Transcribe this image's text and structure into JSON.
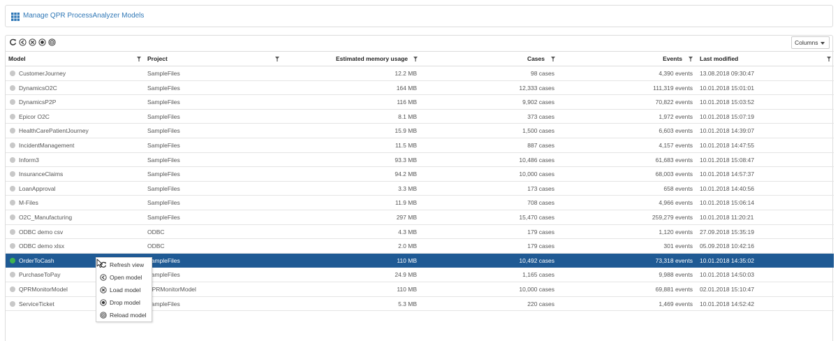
{
  "header": {
    "title": "Manage QPR ProcessAnalyzer Models",
    "icon": "grid-icon"
  },
  "toolbar": {
    "icons": [
      "refresh-icon",
      "open-icon",
      "load-icon",
      "drop-icon",
      "reload-icon"
    ],
    "columns_label": "Columns"
  },
  "table": {
    "headers": {
      "model": "Model",
      "project": "Project",
      "memory": "Estimated memory usage",
      "cases": "Cases",
      "events": "Events",
      "last_modified": "Last modified"
    },
    "rows": [
      {
        "model": "CustomerJourney",
        "project": "SampleFiles",
        "memory": "12.2 MB",
        "cases": "98 cases",
        "events": "4,390 events",
        "last_modified": "13.08.2018 09:30:47",
        "status": "inactive"
      },
      {
        "model": "DynamicsO2C",
        "project": "SampleFiles",
        "memory": "164 MB",
        "cases": "12,333 cases",
        "events": "111,319 events",
        "last_modified": "10.01.2018 15:01:01",
        "status": "inactive"
      },
      {
        "model": "DynamicsP2P",
        "project": "SampleFiles",
        "memory": "116 MB",
        "cases": "9,902 cases",
        "events": "70,822 events",
        "last_modified": "10.01.2018 15:03:52",
        "status": "inactive"
      },
      {
        "model": "Epicor O2C",
        "project": "SampleFiles",
        "memory": "8.1 MB",
        "cases": "373 cases",
        "events": "1,972 events",
        "last_modified": "10.01.2018 15:07:19",
        "status": "inactive"
      },
      {
        "model": "HealthCarePatientJourney",
        "project": "SampleFiles",
        "memory": "15.9 MB",
        "cases": "1,500 cases",
        "events": "6,603 events",
        "last_modified": "10.01.2018 14:39:07",
        "status": "inactive"
      },
      {
        "model": "IncidentManagement",
        "project": "SampleFiles",
        "memory": "11.5 MB",
        "cases": "887 cases",
        "events": "4,157 events",
        "last_modified": "10.01.2018 14:47:55",
        "status": "inactive"
      },
      {
        "model": "Inform3",
        "project": "SampleFiles",
        "memory": "93.3 MB",
        "cases": "10,486 cases",
        "events": "61,683 events",
        "last_modified": "10.01.2018 15:08:47",
        "status": "inactive"
      },
      {
        "model": "InsuranceClaims",
        "project": "SampleFiles",
        "memory": "94.2 MB",
        "cases": "10,000 cases",
        "events": "68,003 events",
        "last_modified": "10.01.2018 14:57:37",
        "status": "inactive"
      },
      {
        "model": "LoanApproval",
        "project": "SampleFiles",
        "memory": "3.3 MB",
        "cases": "173 cases",
        "events": "658 events",
        "last_modified": "10.01.2018 14:40:56",
        "status": "inactive"
      },
      {
        "model": "M-Files",
        "project": "SampleFiles",
        "memory": "11.9 MB",
        "cases": "708 cases",
        "events": "4,966 events",
        "last_modified": "10.01.2018 15:06:14",
        "status": "inactive"
      },
      {
        "model": "O2C_Manufacturing",
        "project": "SampleFiles",
        "memory": "297 MB",
        "cases": "15,470 cases",
        "events": "259,279 events",
        "last_modified": "10.01.2018 11:20:21",
        "status": "inactive"
      },
      {
        "model": "ODBC demo csv",
        "project": "ODBC",
        "memory": "4.3 MB",
        "cases": "179 cases",
        "events": "1,120 events",
        "last_modified": "27.09.2018 15:35:19",
        "status": "inactive"
      },
      {
        "model": "ODBC demo xlsx",
        "project": "ODBC",
        "memory": "2.0 MB",
        "cases": "179 cases",
        "events": "301 events",
        "last_modified": "05.09.2018 10:42:16",
        "status": "inactive"
      },
      {
        "model": "OrderToCash",
        "project": "SampleFiles",
        "memory": "110 MB",
        "cases": "10,492 cases",
        "events": "73,318 events",
        "last_modified": "10.01.2018 14:35:02",
        "status": "active",
        "selected": true
      },
      {
        "model": "PurchaseToPay",
        "project": "SampleFiles",
        "memory": "24.9 MB",
        "cases": "1,165 cases",
        "events": "9,988 events",
        "last_modified": "10.01.2018 14:50:03",
        "status": "inactive"
      },
      {
        "model": "QPRMonitorModel",
        "project": "QPRMonitorModel",
        "memory": "110 MB",
        "cases": "10,000 cases",
        "events": "69,881 events",
        "last_modified": "02.01.2018 15:10:47",
        "status": "inactive"
      },
      {
        "model": "ServiceTicket",
        "project": "SampleFiles",
        "memory": "5.3 MB",
        "cases": "220 cases",
        "events": "1,469 events",
        "last_modified": "10.01.2018 14:52:42",
        "status": "inactive"
      }
    ]
  },
  "context_menu": {
    "items": [
      {
        "label": "Refresh view",
        "icon": "refresh-icon"
      },
      {
        "label": "Open model",
        "icon": "open-icon"
      },
      {
        "label": "Load model",
        "icon": "load-icon"
      },
      {
        "label": "Drop model",
        "icon": "drop-icon"
      },
      {
        "label": "Reload model",
        "icon": "reload-icon"
      }
    ]
  },
  "colors": {
    "accent": "#2f77b6",
    "selected_row": "#1f5a94",
    "active_status": "#3fb34f",
    "inactive_status": "#c8c8c8"
  }
}
